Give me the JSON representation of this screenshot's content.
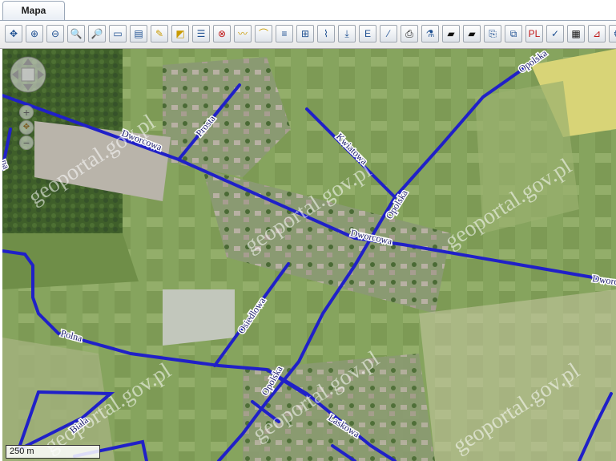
{
  "tabs": [
    {
      "label": "Mapa"
    }
  ],
  "toolbar": {
    "buttons": [
      {
        "name": "pan-icon",
        "glyph": "✥"
      },
      {
        "name": "zoom-in-rect-icon",
        "glyph": "⊕"
      },
      {
        "name": "zoom-out-rect-icon",
        "glyph": "⊖"
      },
      {
        "name": "zoom-in-icon",
        "glyph": "🔍"
      },
      {
        "name": "zoom-out-icon",
        "glyph": "🔎"
      },
      {
        "name": "full-extent-icon",
        "glyph": "▭"
      },
      {
        "name": "previous-extent-icon",
        "glyph": "▤"
      },
      {
        "name": "draw-line-icon",
        "glyph": "✎"
      },
      {
        "name": "select-icon",
        "glyph": "◩"
      },
      {
        "name": "info-icon",
        "glyph": "☰"
      },
      {
        "name": "target-icon",
        "glyph": "⊗"
      },
      {
        "name": "measure-length-icon",
        "glyph": "〰"
      },
      {
        "name": "measure-area-icon",
        "glyph": "⌒"
      },
      {
        "name": "layer-add-icon",
        "glyph": "≡"
      },
      {
        "name": "layer-manage-icon",
        "glyph": "⊞"
      },
      {
        "name": "profile-icon",
        "glyph": "⌇"
      },
      {
        "name": "download-icon",
        "glyph": "⤓"
      },
      {
        "name": "export-icon",
        "glyph": "E"
      },
      {
        "name": "edit-icon",
        "glyph": "⁄"
      },
      {
        "name": "print-icon",
        "glyph": "⎙"
      },
      {
        "name": "analysis-icon",
        "glyph": "⚗"
      },
      {
        "name": "camera-icon",
        "glyph": "▰"
      },
      {
        "name": "camera-alt-icon",
        "glyph": "▰"
      },
      {
        "name": "document-icon",
        "glyph": "⎘"
      },
      {
        "name": "layers-icon",
        "glyph": "⧉"
      },
      {
        "name": "pdf-icon",
        "glyph": "PL"
      },
      {
        "name": "report-icon",
        "glyph": "✓"
      },
      {
        "name": "grid-icon",
        "glyph": "▦"
      },
      {
        "name": "chart-icon",
        "glyph": "⊿"
      },
      {
        "name": "settings-icon",
        "glyph": "⚙"
      }
    ]
  },
  "map": {
    "streets": [
      {
        "name": "dworcowa-label-1",
        "text": "Dworcowa"
      },
      {
        "name": "dworcowa-label-2",
        "text": "Dworcowa"
      },
      {
        "name": "dworcowa-label-3",
        "text": "Dworc"
      },
      {
        "name": "prosta-label",
        "text": "Prosta"
      },
      {
        "name": "kwiatowa-label",
        "text": "Kwiatowa"
      },
      {
        "name": "opolska-label-1",
        "text": "Opolska"
      },
      {
        "name": "opolska-label-2",
        "text": "Opolska"
      },
      {
        "name": "opolska-label-3",
        "text": "Opolska"
      },
      {
        "name": "osiedlowa-label",
        "text": "Osiedlowa"
      },
      {
        "name": "polna-label",
        "text": "Polna"
      },
      {
        "name": "biala-label",
        "text": "Biała"
      },
      {
        "name": "laskowa-label",
        "text": "Laskowa"
      },
      {
        "name": "edge-left-label",
        "text": "na"
      }
    ],
    "watermark": "geoportal.gov.pl",
    "scale": "250 m",
    "colors": {
      "road": "#2020c8",
      "label_bg": "#ffffff"
    }
  }
}
